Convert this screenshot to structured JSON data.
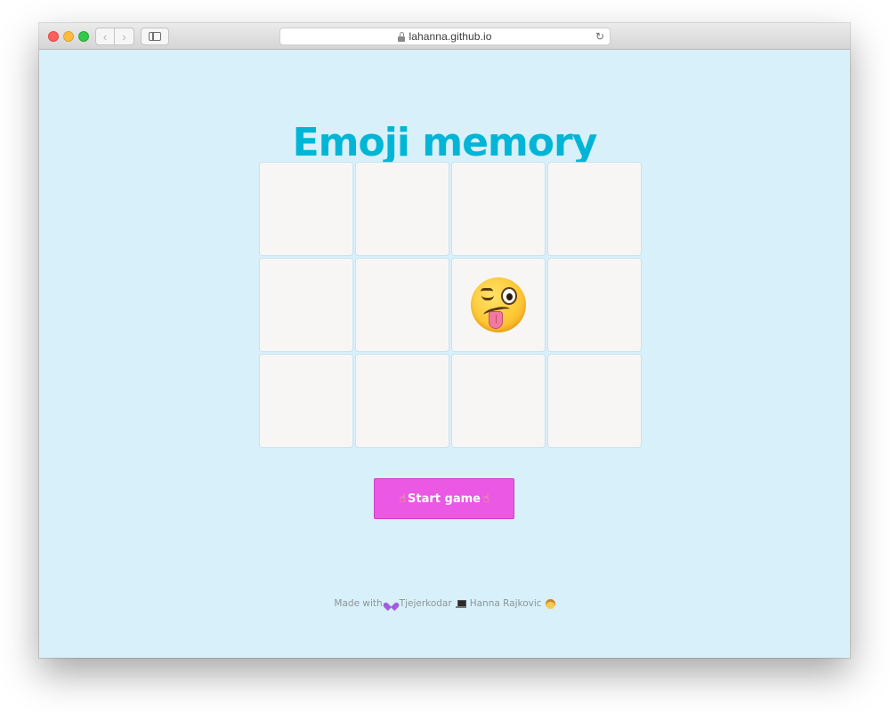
{
  "browser": {
    "url": "lahanna.github.io",
    "nav_back_icon": "chevron-left-icon",
    "nav_forward_icon": "chevron-right-icon",
    "sidebar_icon": "sidebar-icon",
    "lock_icon": "lock-icon",
    "reload_icon": "reload-icon",
    "traffic_light_colors": {
      "close": "#fc605c",
      "minimize": "#fdbc40",
      "zoom": "#34c84a"
    }
  },
  "page": {
    "title": "Emoji memory",
    "title_color": "#00b5d6",
    "background": "#d8f0f9"
  },
  "board": {
    "rows": 3,
    "columns": 4,
    "cards": [
      {
        "state": "hidden"
      },
      {
        "state": "hidden"
      },
      {
        "state": "hidden"
      },
      {
        "state": "hidden"
      },
      {
        "state": "hidden"
      },
      {
        "state": "hidden"
      },
      {
        "state": "revealed",
        "emoji": "winking-face-with-tongue"
      },
      {
        "state": "hidden"
      },
      {
        "state": "hidden"
      },
      {
        "state": "hidden"
      },
      {
        "state": "hidden"
      },
      {
        "state": "hidden"
      }
    ]
  },
  "start_button": {
    "label": "Start game",
    "left_icon": "pointing-finger-icon",
    "right_icon": "pointing-finger-icon",
    "color": "#ea58e4"
  },
  "footer": {
    "made_with": "Made with",
    "heart_icon": "purple-heart-icon",
    "org": "Tjejerkodar",
    "laptop_icon": "laptop-icon",
    "author": "Hanna Rajkovic",
    "woman_icon": "woman-icon"
  }
}
